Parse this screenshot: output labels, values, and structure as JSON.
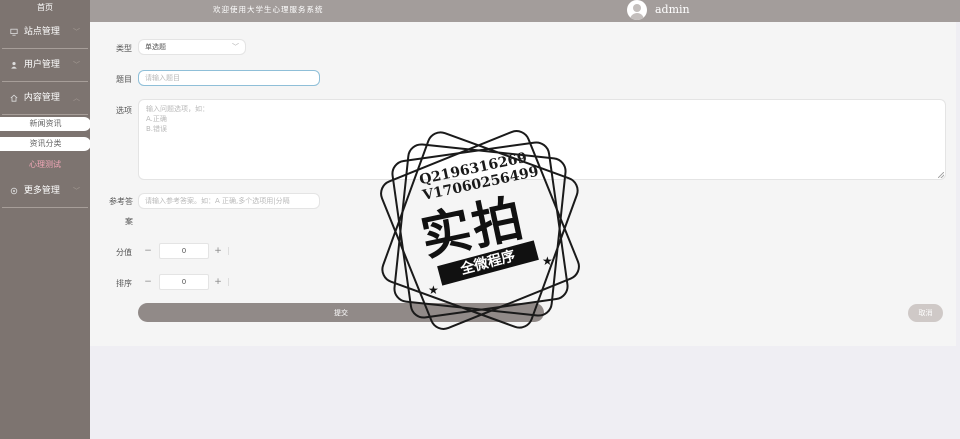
{
  "sidebar": {
    "home": "首页",
    "groups": [
      {
        "label": "站点管理",
        "icon": "monitor-icon"
      },
      {
        "label": "用户管理",
        "icon": "user-icon"
      },
      {
        "label": "内容管理",
        "icon": "home-icon"
      },
      {
        "label": "更多管理",
        "icon": "settings-icon"
      }
    ],
    "content_sub": [
      {
        "label": "新闻资讯"
      },
      {
        "label": "资讯分类"
      },
      {
        "label": "心理测试",
        "active": true
      }
    ]
  },
  "header": {
    "welcome": "欢迎使用大学生心理服务系统",
    "username": "admin"
  },
  "form": {
    "type_label": "类型",
    "type_value": "单选题",
    "title_label": "题目",
    "title_placeholder": "请输入题目",
    "options_label": "选项",
    "options_placeholder": "输入问题选项，如：\nA.正确\nB.错误",
    "answer_label_1": "参考答",
    "answer_label_2": "案",
    "answer_placeholder": "请输入参考答案。如：A 正确,多个选项用|分隔",
    "score_label": "分值",
    "score_value": "0",
    "sort_label": "排序",
    "sort_value": "0",
    "minus": "−",
    "plus": "+",
    "submit": "提交",
    "cancel": "取消"
  },
  "watermark": {
    "line1": "Q2196316269",
    "line2": "V17060256499",
    "big": "实拍",
    "ribbon": "全微程序"
  }
}
